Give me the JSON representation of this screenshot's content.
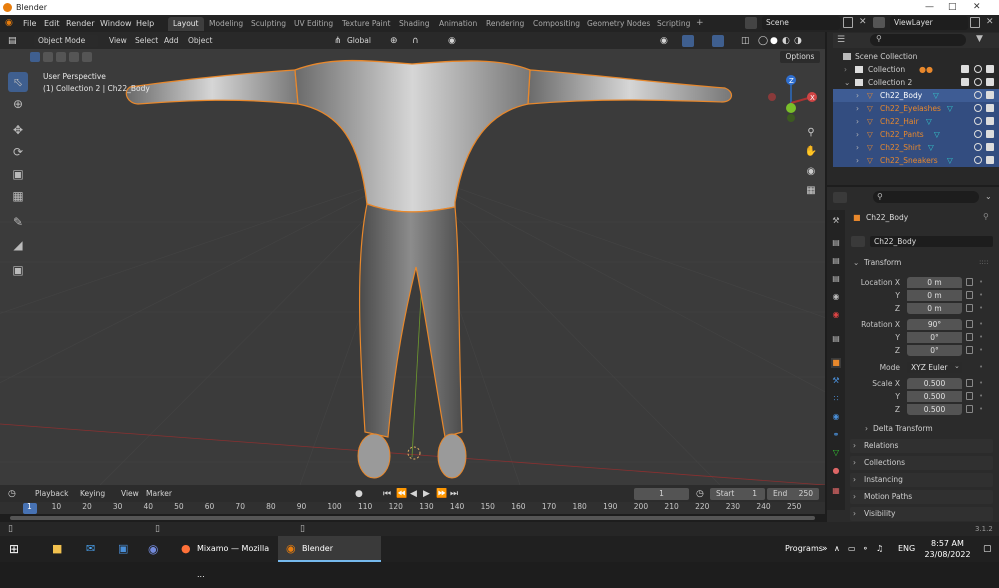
{
  "window": {
    "title": "Blender"
  },
  "menu": [
    "File",
    "Edit",
    "Render",
    "Window",
    "Help"
  ],
  "workspaces": [
    "Layout",
    "Modeling",
    "Sculpting",
    "UV Editing",
    "Texture Paint",
    "Shading",
    "Animation",
    "Rendering",
    "Compositing",
    "Geometry Nodes",
    "Scripting"
  ],
  "active_workspace": "Layout",
  "scene": {
    "label": "Scene",
    "viewlayer": "ViewLayer"
  },
  "viewport": {
    "mode": "Object Mode",
    "menus": [
      "View",
      "Select",
      "Add",
      "Object"
    ],
    "orientation": "Global",
    "options": "Options",
    "info_line1": "User Perspective",
    "info_line2": "(1) Collection 2 | Ch22_Body",
    "gizmo_labels": {
      "x": "X",
      "y": "Y",
      "z": "Z"
    }
  },
  "outliner": {
    "rows": [
      {
        "label": "Scene Collection",
        "indent": 0
      },
      {
        "label": "Collection",
        "indent": 1
      },
      {
        "label": "Collection 2",
        "indent": 1
      },
      {
        "label": "Ch22_Body",
        "indent": 2,
        "selected": true,
        "active": true
      },
      {
        "label": "Ch22_Eyelashes",
        "indent": 2,
        "selected": true
      },
      {
        "label": "Ch22_Hair",
        "indent": 2,
        "selected": true
      },
      {
        "label": "Ch22_Pants",
        "indent": 2,
        "selected": true
      },
      {
        "label": "Ch22_Shirt",
        "indent": 2,
        "selected": true
      },
      {
        "label": "Ch22_Sneakers",
        "indent": 2,
        "selected": true
      }
    ]
  },
  "properties": {
    "object_name": "Ch22_Body",
    "data_name": "Ch22_Body",
    "transform_header": "Transform",
    "location": {
      "label": "Location X",
      "x": "0 m",
      "y": "0 m",
      "z": "0 m"
    },
    "rotation": {
      "label": "Rotation X",
      "x": "90°",
      "y": "0°",
      "z": "0°"
    },
    "mode": {
      "label": "Mode",
      "value": "XYZ Euler"
    },
    "scale": {
      "label": "Scale X",
      "x": "0.500",
      "y": "0.500",
      "z": "0.500"
    },
    "axis_labels": {
      "y": "Y",
      "z": "Z"
    },
    "panels": [
      "Delta Transform",
      "Relations",
      "Collections",
      "Instancing",
      "Motion Paths",
      "Visibility"
    ]
  },
  "timeline": {
    "menus": [
      "Playback",
      "Keying",
      "View",
      "Marker"
    ],
    "current_frame": "1",
    "start_label": "Start",
    "start": "1",
    "end_label": "End",
    "end": "250",
    "ticks": [
      "1",
      "10",
      "20",
      "30",
      "40",
      "50",
      "60",
      "70",
      "80",
      "90",
      "100",
      "110",
      "120",
      "130",
      "140",
      "150",
      "160",
      "170",
      "180",
      "190",
      "200",
      "210",
      "220",
      "230",
      "240",
      "250"
    ]
  },
  "status": {
    "version": "3.1.2"
  },
  "taskbar": {
    "apps": [
      "Mixamo — Mozilla ...",
      "Blender"
    ],
    "programs": "Programs",
    "lang": "ENG",
    "time": "8:57 AM",
    "date": "23/08/2022"
  },
  "colors": {
    "accent_blue": "#334d80",
    "orange_outline": "#e8882c",
    "grid_bg": "#3b3b3b"
  }
}
